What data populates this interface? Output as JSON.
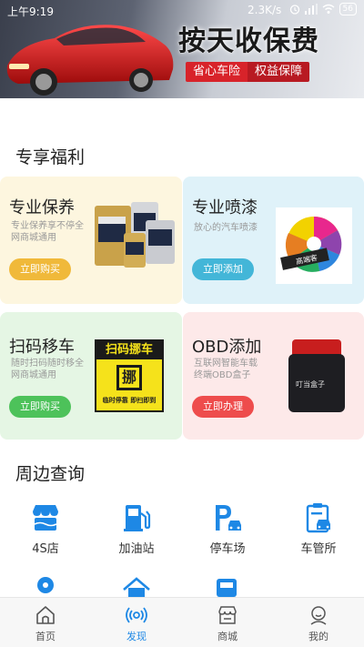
{
  "status_bar": {
    "time": "上午9:19",
    "network_speed": "2.3K/s",
    "battery": "56"
  },
  "banner": {
    "headline": "按天收保费",
    "tag_left": "省心车险",
    "tag_right": "权益保障"
  },
  "benefits": {
    "title": "专享福利",
    "cards": [
      {
        "title": "专业保养",
        "desc": "专业保养享不停全网商城通用",
        "button": "立即购买",
        "bg": "#fdf6df",
        "button_color": "#f0b93a"
      },
      {
        "title": "专业喷漆",
        "desc": "放心的汽车喷漆",
        "button": "立即添加",
        "bg": "#dff2f9",
        "button_color": "#43b6d8",
        "brand": "高端客"
      },
      {
        "title": "扫码移车",
        "desc": "随时扫码随时移全网商城通用",
        "button": "立即购买",
        "bg": "#e5f6e4",
        "button_color": "#4dc25a",
        "sign_title": "扫码挪车",
        "sign_char": "挪",
        "sign_bottom": "临时停靠 即扫即到"
      },
      {
        "title": "OBD添加",
        "desc": "互联网智能车载终端OBD盒子",
        "button": "立即办理",
        "bg": "#fde9e9",
        "button_color": "#ee4c4c",
        "brand": "叮当盒子"
      }
    ]
  },
  "nearby": {
    "title": "周边查询",
    "items": [
      {
        "label": "4S店",
        "icon": "shop-icon"
      },
      {
        "label": "加油站",
        "icon": "gas-station-icon"
      },
      {
        "label": "停车场",
        "icon": "parking-icon"
      },
      {
        "label": "车管所",
        "icon": "vehicle-office-icon"
      }
    ]
  },
  "tabbar": {
    "items": [
      {
        "label": "首页",
        "icon": "home-icon"
      },
      {
        "label": "发现",
        "icon": "discover-icon",
        "active": true
      },
      {
        "label": "商城",
        "icon": "store-icon"
      },
      {
        "label": "我的",
        "icon": "profile-icon"
      }
    ],
    "active_color": "#1e88e5"
  },
  "colors": {
    "icon_blue": "#1e88e5"
  }
}
